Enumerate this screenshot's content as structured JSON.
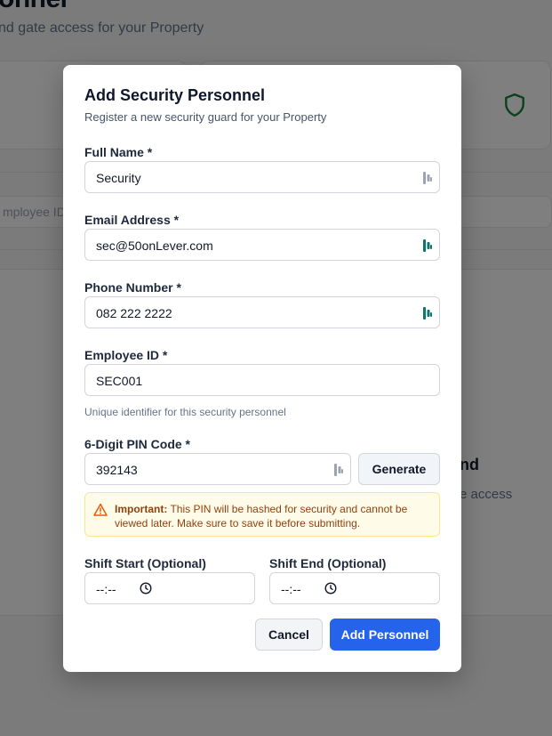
{
  "background": {
    "title": "onnel",
    "subtitle": "nd gate access for your Property",
    "search_placeholder": "mployee ID,",
    "empty_title": "nd",
    "empty_desc": "e access"
  },
  "modal": {
    "title": "Add Security Personnel",
    "description": "Register a new security guard for your Property",
    "full_name": {
      "label": "Full Name *",
      "value": "Security"
    },
    "email": {
      "label": "Email Address *",
      "value": "sec@50onLever.com"
    },
    "phone": {
      "label": "Phone Number *",
      "value": "082 222 2222"
    },
    "employee_id": {
      "label": "Employee ID *",
      "value": "SEC001",
      "hint": "Unique identifier for this security personnel"
    },
    "pin": {
      "label": "6-Digit PIN Code *",
      "value": "392143",
      "generate_label": "Generate"
    },
    "warning": {
      "strong": "Important:",
      "text": " This PIN will be hashed for security and cannot be viewed later. Make sure to save it before submitting."
    },
    "shift_start": {
      "label": "Shift Start (Optional)",
      "value": "--:--"
    },
    "shift_end": {
      "label": "Shift End (Optional)",
      "value": "--:--"
    },
    "cancel_label": "Cancel",
    "submit_label": "Add Personnel"
  },
  "colors": {
    "primary": "#2563eb",
    "shield": "#15803d",
    "warning_bg": "#fefce8",
    "warning_text": "#92400e"
  },
  "icons": {
    "password_manager": "password-manager-icon",
    "shield": "shield-icon",
    "warning": "warning-triangle-icon",
    "clock": "clock-icon"
  }
}
